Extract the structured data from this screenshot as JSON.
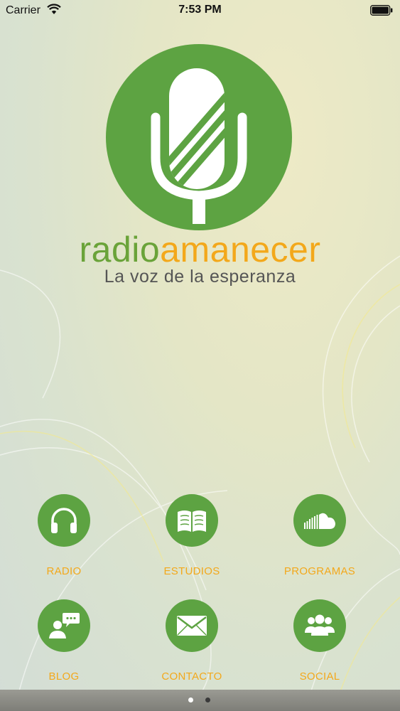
{
  "status_bar": {
    "carrier": "Carrier",
    "time": "7:53 PM"
  },
  "brand": {
    "part1": "radio",
    "part2": "amanecer",
    "tagline": "La voz de la esperanza"
  },
  "colors": {
    "green": "#5da342",
    "orange": "#f3a81b",
    "text_gray": "#555555"
  },
  "menu": [
    {
      "label": "RADIO",
      "icon": "headphones-icon"
    },
    {
      "label": "ESTUDIOS",
      "icon": "book-icon"
    },
    {
      "label": "PROGRAMAS",
      "icon": "soundcloud-icon"
    },
    {
      "label": "BLOG",
      "icon": "chat-user-icon"
    },
    {
      "label": "CONTACTO",
      "icon": "envelope-icon"
    },
    {
      "label": "SOCIAL",
      "icon": "group-icon"
    }
  ],
  "pager": {
    "current_page": 1,
    "total_pages": 2
  }
}
